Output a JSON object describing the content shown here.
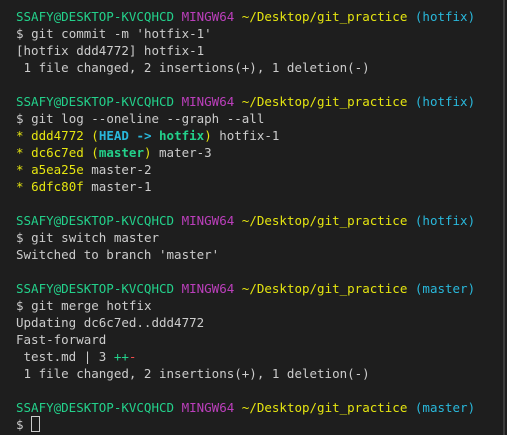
{
  "prompt": {
    "user_host": "SSAFY@DESKTOP-KVCQHCD",
    "shell": "MINGW64",
    "path": "~/Desktop/git_practice",
    "symbol": "$"
  },
  "blocks": [
    {
      "branch": "(hotfix)",
      "command": "git commit -m 'hotfix-1'",
      "output": [
        "[hotfix ddd4772] hotfix-1",
        " 1 file changed, 2 insertions(+), 1 deletion(-)"
      ]
    },
    {
      "branch": "(hotfix)",
      "command": "git log --oneline --graph --all",
      "log": [
        {
          "hash": "ddd4772",
          "refs_head": "HEAD -> ",
          "refs_branch": "hotfix",
          "msg": "hotfix-1"
        },
        {
          "hash": "dc6c7ed",
          "refs_branch": "master",
          "msg": "mater-3"
        },
        {
          "hash": "a5ea25e",
          "msg": "master-2"
        },
        {
          "hash": "6dfc80f",
          "msg": "master-1"
        }
      ]
    },
    {
      "branch": "(hotfix)",
      "command": "git switch master",
      "output": [
        "Switched to branch 'master'"
      ]
    },
    {
      "branch": "(master)",
      "command": "git merge hotfix",
      "output": [
        "Updating dc6c7ed..ddd4772",
        "Fast-forward"
      ],
      "diffstat": {
        "file": " test.md | 3 ",
        "plus": "++",
        "minus": "-"
      },
      "summary": " 1 file changed, 2 insertions(+), 1 deletion(-)"
    },
    {
      "branch": "(master)"
    }
  ],
  "colors": {
    "background": "#1e1e1e",
    "text": "#cccccc",
    "user_host": "#23d18b",
    "shell": "#bc3fbc",
    "path": "#e5e510",
    "branch": "#29b8db"
  }
}
